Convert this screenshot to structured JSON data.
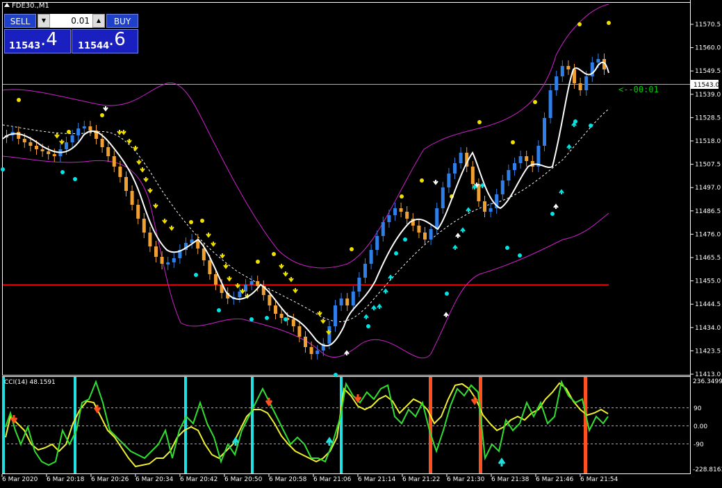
{
  "window": {
    "title": "FDE30.,M1"
  },
  "trade_panel": {
    "sell_label": "SELL",
    "buy_label": "BUY",
    "lot_value": "0.01",
    "lot_down": "▼",
    "lot_up": "▲",
    "bid_big": "11543",
    "bid_pip": ".4",
    "ask_big": "11544",
    "ask_pip": ".6"
  },
  "main_price_axis": [
    "11570.5",
    "11560.0",
    "11549.5",
    "11539.0",
    "11528.5",
    "11518.0",
    "11507.5",
    "11497.0",
    "11486.5",
    "11476.0",
    "11465.5",
    "11455.0",
    "11444.5",
    "11434.0",
    "11423.5",
    "11413.0"
  ],
  "current_price_label": "11543.0",
  "countdown": "<--00:01",
  "cci": {
    "title": "CCI(14) 48.1591",
    "axis": [
      "236.3499",
      "90",
      "0.00",
      "-90",
      "-228.8163"
    ]
  },
  "time_axis": [
    "6 Mar 2020",
    "6 Mar 20:18",
    "6 Mar 20:26",
    "6 Mar 20:34",
    "6 Mar 20:42",
    "6 Mar 20:50",
    "6 Mar 20:58",
    "6 Mar 21:06",
    "6 Mar 21:14",
    "6 Mar 21:22",
    "6 Mar 21:30",
    "6 Mar 21:38",
    "6 Mar 21:46",
    "6 Mar 21:54"
  ],
  "colors": {
    "background": "#000000",
    "bull_candle": "#2f7fe8",
    "bear_candle": "#f0a030",
    "doji_candle": "#a0a0a0",
    "bands": "#d020d0",
    "ma_line": "#ffffff",
    "support_line": "#ff0000",
    "price_line": "#b0b0b0",
    "countdown": "#00cc00",
    "dot_above": "#f0e000",
    "dot_below": "#00e5e5",
    "cci_green": "#30e030",
    "cci_yellow": "#f0f030",
    "cci_cyan_bar": "#20e0e0",
    "cci_red_bar": "#ff5020"
  }
}
